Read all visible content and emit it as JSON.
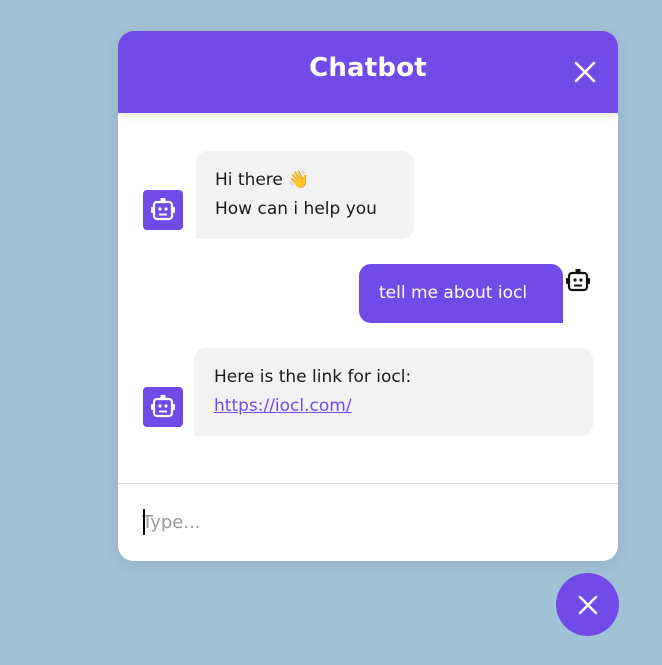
{
  "chatbot": {
    "title": "Chatbot",
    "messages": [
      {
        "role": "incoming",
        "line1": "Hi there 👋",
        "line2": "How can i help you"
      },
      {
        "role": "outgoing",
        "text": "tell me about iocl"
      },
      {
        "role": "incoming",
        "text": "Here is the link for iocl:",
        "link": "https://iocl.com/"
      }
    ],
    "input": {
      "placeholder": "Type...",
      "value": ""
    }
  },
  "colors": {
    "accent": "#724ae8",
    "background": "#a1c1d6",
    "incoming_bubble": "#f2f2f2"
  },
  "icons": {
    "header_close": "close-icon",
    "bot_avatar": "robot-icon",
    "toggler": "close-icon"
  }
}
